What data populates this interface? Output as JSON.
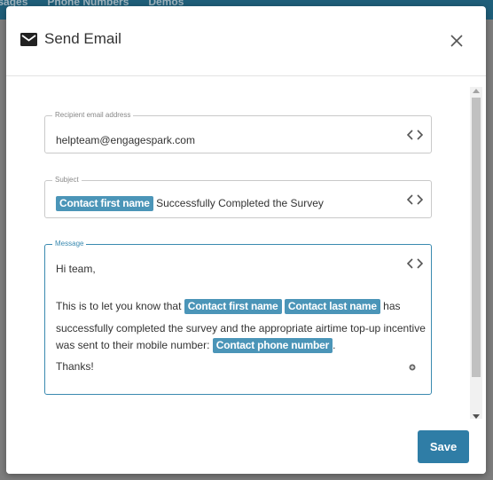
{
  "background_nav": [
    "essages",
    "Phone Numbers",
    "Demos"
  ],
  "modal": {
    "title": "Send Email",
    "header_icon": "envelope-icon",
    "close_icon": "close-icon"
  },
  "recipient": {
    "label": "Recipient email address",
    "value": "helpteam@engagespark.com"
  },
  "subject": {
    "label": "Subject",
    "tag": "Contact first name",
    "text": "Successfully Completed the Survey"
  },
  "message": {
    "label": "Message",
    "line1": "Hi team,",
    "line2_prefix": "This is to let you know that",
    "tag_first": "Contact first name",
    "tag_last": "Contact last name",
    "line2_suffix": "has",
    "line3": "successfully completed the survey and the appropriate airtime top-up incentive",
    "line4_prefix": "was sent to their mobile number:",
    "tag_phone": "Contact phone number",
    "line4_suffix": ".",
    "line5": "Thanks!"
  },
  "footer": {
    "save_label": "Save"
  },
  "colors": {
    "primary": "#2f7da6",
    "tag": "#4b95b8",
    "focus": "#3a8ab0"
  }
}
